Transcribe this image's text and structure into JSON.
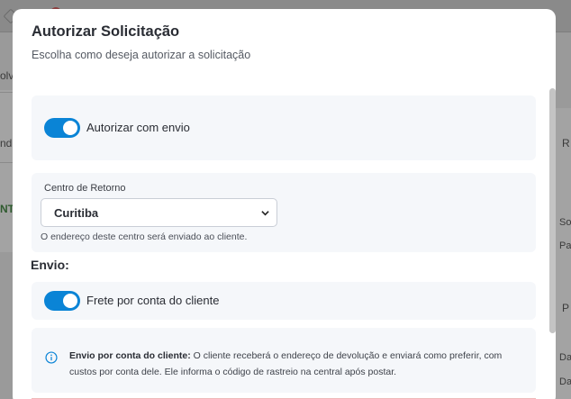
{
  "background": {
    "left_texts": [
      "olvi",
      "nd",
      "NT"
    ],
    "right_texts": [
      "R",
      "So",
      "Pa",
      "P",
      "Da",
      "Da"
    ]
  },
  "modal": {
    "title": "Autorizar Solicitação",
    "subtitle": "Escolha como deseja autorizar a solicitação",
    "toggle_envio": {
      "label": "Autorizar com envio",
      "on": true
    },
    "return_center": {
      "label": "Centro de Retorno",
      "selected": "Curitiba",
      "hint": "O endereço deste centro será enviado ao cliente."
    },
    "envio_heading": "Envio:",
    "toggle_frete": {
      "label": "Frete por conta do cliente",
      "on": true
    },
    "info": {
      "bold": "Envio por conta do cliente:",
      "text": " O cliente receberá o endereço de devolução e enviará como preferir, com custos por conta dele. Ele informa o código de rastreio na central após postar."
    }
  },
  "colors": {
    "accent": "#0a84d6",
    "overlay": "#9a9a9a",
    "section_bg": "#f5f7fa"
  }
}
